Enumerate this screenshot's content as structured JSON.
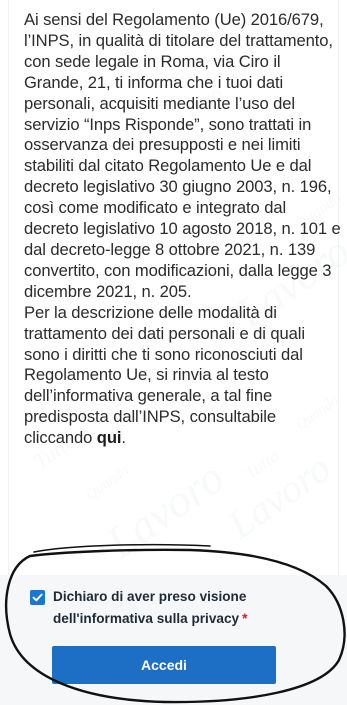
{
  "privacy": {
    "paragraph1": "Ai sensi del Regolamento (Ue) 2016/679, l’INPS, in qualità di titolare del trattamento, con sede legale in Roma, via Ciro il Grande, 21, ti informa che i tuoi dati personali, acquisiti mediante l’uso del servizio “Inps Risponde”, sono trattati in osservanza dei presupposti e nei limiti stabiliti dal citato Regolamento Ue e dal decreto legislativo 30 giugno 2003, n. 196, così come modificato e integrato dal decreto legislativo 10 agosto 2018, n. 101 e dal decreto-legge 8 ottobre 2021, n. 139 convertito, con modificazioni, dalla legge 3 dicembre 2021, n. 205.",
    "paragraph2": "Per la descrizione delle modalità di trattamento dei dati personali e di quali sono i diritti che ti sono riconosciuti dal Regolamento Ue, si rinvia al testo dell’informativa generale, a tal fine predisposta dall’INPS, consultabile cliccando",
    "link_label": "qui",
    "link_suffix": "."
  },
  "consent": {
    "checked": true,
    "label": "Dichiaro di aver preso visione dell'informativa sulla privacy",
    "required_mark": "*"
  },
  "actions": {
    "submit_label": "Accedi"
  },
  "watermark": {
    "lines": [
      "Tutto",
      "Lavoro",
      "Quando",
      "Tutto",
      "Lavoro",
      "Quando",
      "Tutto",
      "Lavoro",
      "Quando",
      "Tutto",
      "Lavoro"
    ]
  },
  "colors": {
    "button": "#1d6fc5",
    "checkbox": "#1a77d2",
    "required": "#d0202a",
    "annotation": "#111111"
  },
  "icons": {
    "checkbox": "check-icon"
  }
}
